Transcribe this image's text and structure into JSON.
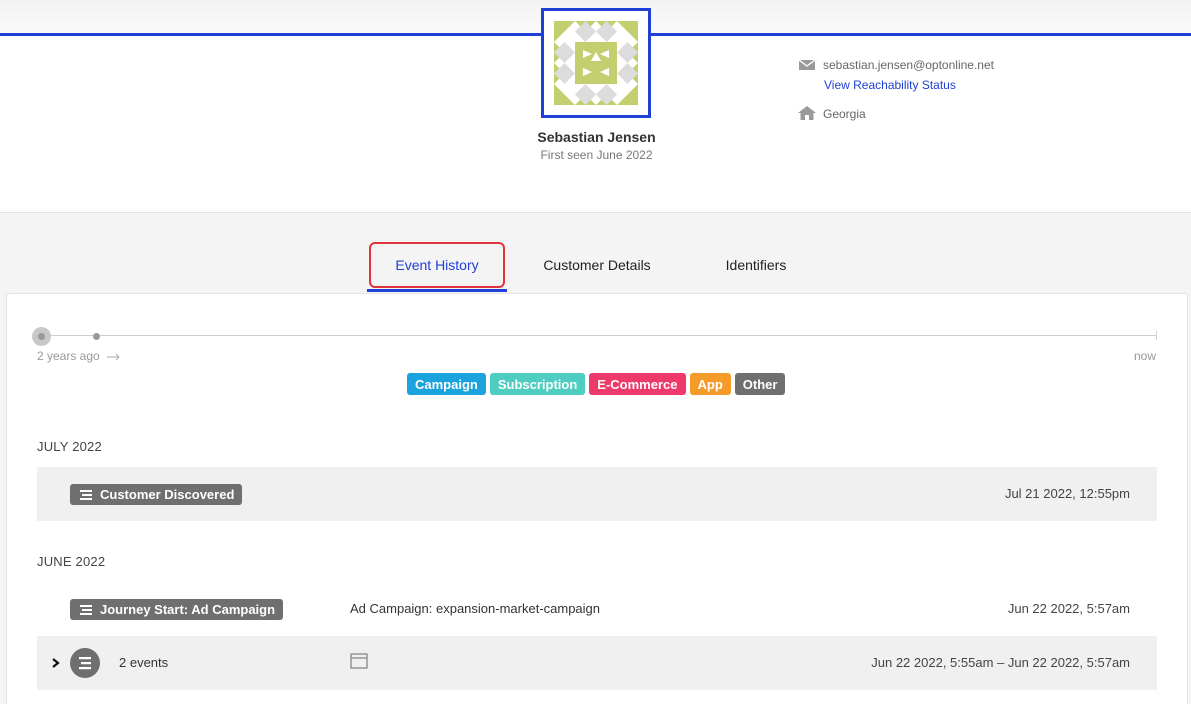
{
  "profile": {
    "name": "Sebastian Jensen",
    "first_seen": "First seen June 2022",
    "email": "sebastian.jensen@optonline.net",
    "reachability_link": "View Reachability Status",
    "location": "Georgia",
    "icons": {
      "email": "envelope-icon",
      "location": "home-icon"
    },
    "avatar_colors": {
      "green": "#c3cf6e",
      "grey": "#dcdcdc"
    }
  },
  "accent_color": "#1f3fd6",
  "tabs": [
    {
      "label": "Event History",
      "active": true
    },
    {
      "label": "Customer Details",
      "active": false
    },
    {
      "label": "Identifiers",
      "active": false
    }
  ],
  "timeline": {
    "start_label": "2 years ago",
    "end_label": "now"
  },
  "filters": [
    {
      "label": "Campaign",
      "color": "#1aa3dc"
    },
    {
      "label": "Subscription",
      "color": "#4ecdc0"
    },
    {
      "label": "E-Commerce",
      "color": "#ee3a6a"
    },
    {
      "label": "App",
      "color": "#f59b2a"
    },
    {
      "label": "Other",
      "color": "#6f6f6f"
    }
  ],
  "history": [
    {
      "month": "JULY 2022",
      "events": [
        {
          "tag": "Customer Discovered",
          "description": "",
          "time": "Jul 21 2022, 12:55pm"
        }
      ]
    },
    {
      "month": "JUNE 2022",
      "events": [
        {
          "tag": "Journey Start: Ad Campaign",
          "description": "Ad Campaign: expansion-market-campaign",
          "time": "Jun 22 2022, 5:57am"
        }
      ],
      "group": {
        "count_label": "2 events",
        "time": "Jun 22 2022, 5:55am – Jun 22 2022, 5:57am"
      }
    }
  ]
}
